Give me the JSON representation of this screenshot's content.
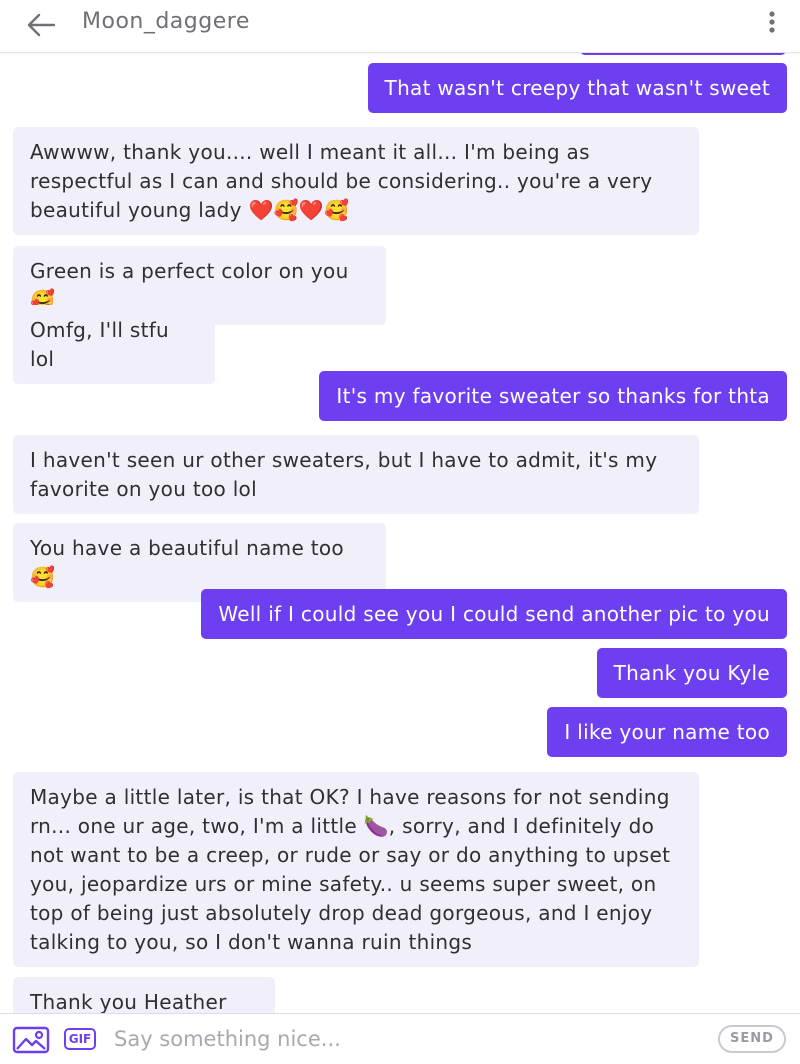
{
  "header": {
    "title": "Moon_daggere",
    "back_icon": "arrow-left-icon",
    "menu_icon": "more-vertical-icon"
  },
  "messages": [
    {
      "dir": "out",
      "text": "That wasn't creepy that wasn't sweet"
    },
    {
      "dir": "in",
      "text": "Awwww, thank you.... well I meant it all... I'm being as respectful as I can and should be considering..  you're a very beautiful young lady ❤️🥰❤️🥰"
    },
    {
      "dir": "in",
      "text": "Green is a perfect color on you🥰"
    },
    {
      "dir": "in",
      "text": "Omfg, I'll stfu lol"
    },
    {
      "dir": "out",
      "text": "It's my favorite sweater so thanks for thta"
    },
    {
      "dir": "in",
      "text": "I haven't seen ur other sweaters, but I have to admit, it's my favorite on you too lol"
    },
    {
      "dir": "in",
      "text": "You have a beautiful name too 🥰"
    },
    {
      "dir": "out",
      "text": "Well if I could see you I could send another pic to you"
    },
    {
      "dir": "out",
      "text": "Thank you Kyle"
    },
    {
      "dir": "out",
      "text": "I like your name too"
    },
    {
      "dir": "in",
      "text": "Maybe a little later, is that OK? I have reasons for not sending rn... one ur age, two, I'm a little 🍆, sorry, and I definitely do not want to be a creep, or rude or say or do anything to upset you, jeopardize urs or mine safety.. u seems super sweet, on top of being just absolutely drop dead gorgeous, and I enjoy talking to you, so I don't wanna ruin things"
    },
    {
      "dir": "in",
      "text": "Thank you Heather 🥰"
    }
  ],
  "composer": {
    "image_icon": "image-icon",
    "gif_label": "GIF",
    "placeholder": "Say something nice...",
    "send_label": "SEND"
  },
  "colors": {
    "outgoing_bubble": "#6e3ff1",
    "incoming_bubble": "#f1eff9",
    "incoming_text": "#2f2f35",
    "header_text": "#6f6f78"
  }
}
